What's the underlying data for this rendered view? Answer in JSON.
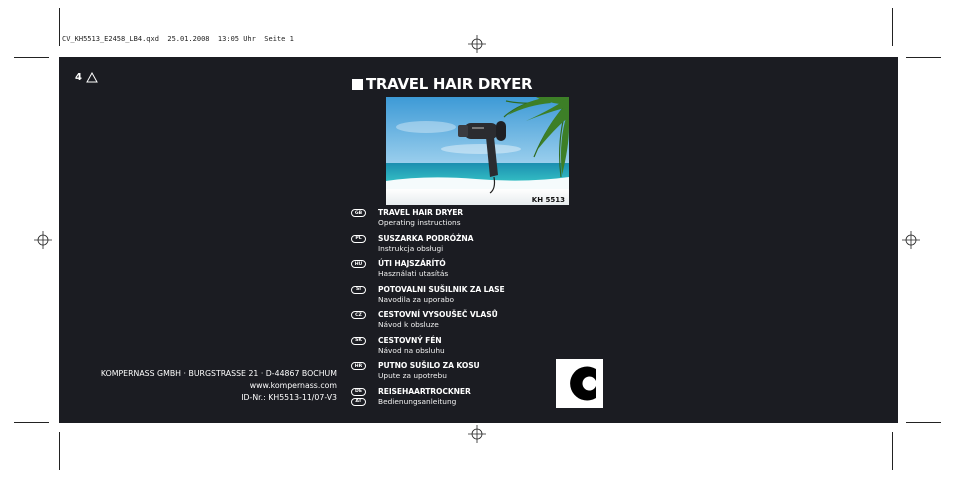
{
  "slug": "CV_KH5513_E2458_LB4.qxd  25.01.2008  13:05 Uhr  Seite 1",
  "page": {
    "number": "4"
  },
  "title": "TRAVEL HAIR DRYER",
  "product": {
    "model": "KH 5513"
  },
  "languages": [
    {
      "codes": [
        "GB"
      ],
      "name": "TRAVEL HAIR DRYER",
      "subtitle": "Operating instructions"
    },
    {
      "codes": [
        "PL"
      ],
      "name": "SUSZARKA PODRÓŻNA",
      "subtitle": "Instrukcja obsługi"
    },
    {
      "codes": [
        "HU"
      ],
      "name": "ÚTI HAJSZÁRÍTÓ",
      "subtitle": "Használati utasítás"
    },
    {
      "codes": [
        "SI"
      ],
      "name": "POTOVALNI SUŠILNIK ZA LASE",
      "subtitle": "Navodila za uporabo"
    },
    {
      "codes": [
        "CZ"
      ],
      "name": "CESTOVNÍ VYSOUŠEČ VLASŮ",
      "subtitle": "Návod k obsluze"
    },
    {
      "codes": [
        "SK"
      ],
      "name": "CESTOVNÝ FÉN",
      "subtitle": "Návod na obsluhu"
    },
    {
      "codes": [
        "HR"
      ],
      "name": "PUTNO SUŠILO ZA KOSU",
      "subtitle": "Upute za upotrebu"
    },
    {
      "codes": [
        "DE",
        "AT"
      ],
      "name": "REISEHAARTROCKNER",
      "subtitle": "Bedienungsanleitung"
    }
  ],
  "address": {
    "company": "KOMPERNASS GMBH · BURGSTRASSE 21 · D-44867 BOCHUM",
    "website": "www.kompernass.com",
    "id": "ID-Nr.: KH5513-11/07-V3"
  },
  "colors": {
    "background": "#1b1c22",
    "text": "#ffffff",
    "sea": "#1aa0b0",
    "sky": "#4aa8e0"
  },
  "icons": {
    "warning": "warning-triangle-icon",
    "logo": "kompernass-logo-icon"
  }
}
